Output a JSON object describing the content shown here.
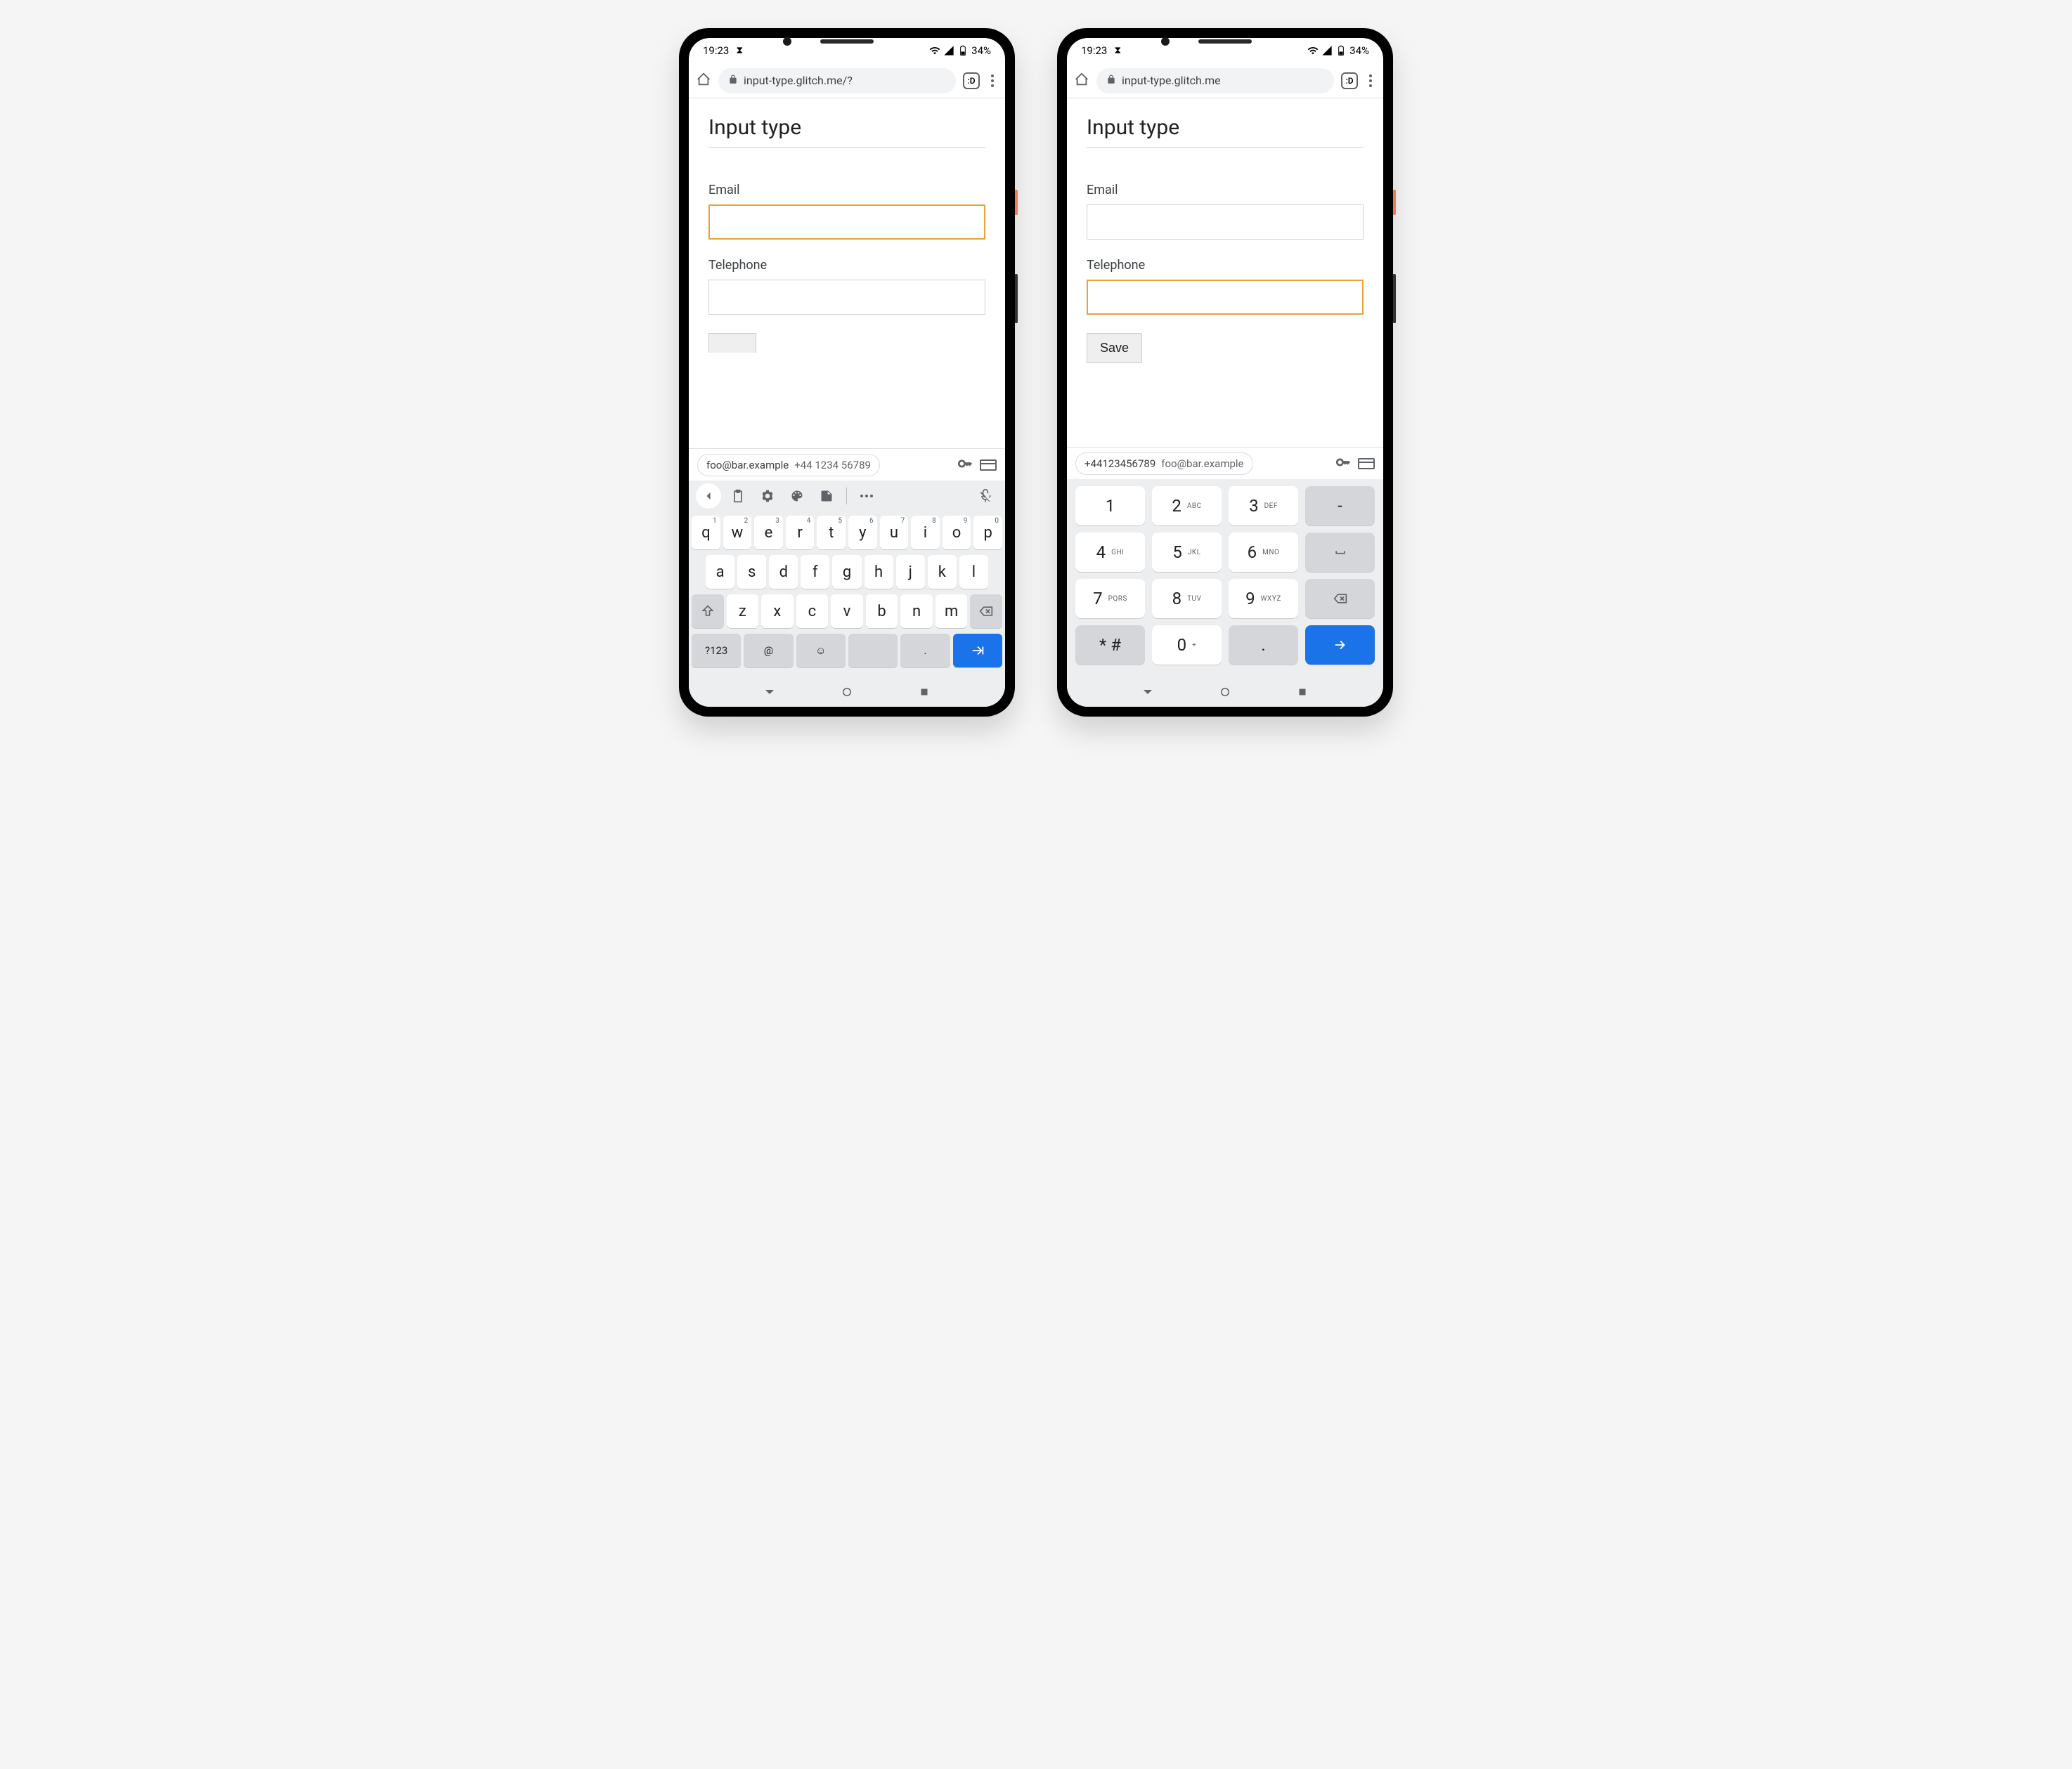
{
  "status": {
    "time": "19:23",
    "battery": "34%"
  },
  "browser": {
    "url_left": "input-type.glitch.me/?",
    "url_right": "input-type.glitch.me",
    "tab_count": ":D"
  },
  "page": {
    "title": "Input type",
    "email_label": "Email",
    "telephone_label": "Telephone",
    "save_label": "Save"
  },
  "autofill": {
    "left_chip_primary": "foo@bar.example",
    "left_chip_secondary": "+44 1234 56789",
    "right_chip_primary": "+44123456789",
    "right_chip_secondary": "foo@bar.example"
  },
  "qwerty": {
    "row1": [
      {
        "k": "q",
        "n": "1"
      },
      {
        "k": "w",
        "n": "2"
      },
      {
        "k": "e",
        "n": "3"
      },
      {
        "k": "r",
        "n": "4"
      },
      {
        "k": "t",
        "n": "5"
      },
      {
        "k": "y",
        "n": "6"
      },
      {
        "k": "u",
        "n": "7"
      },
      {
        "k": "i",
        "n": "8"
      },
      {
        "k": "o",
        "n": "9"
      },
      {
        "k": "p",
        "n": "0"
      }
    ],
    "row2": [
      "a",
      "s",
      "d",
      "f",
      "g",
      "h",
      "j",
      "k",
      "l"
    ],
    "row3": [
      "z",
      "x",
      "c",
      "v",
      "b",
      "n",
      "m"
    ],
    "symbols_label": "?123",
    "at_label": "@",
    "period_label": "."
  },
  "numpad": {
    "keys": [
      [
        {
          "d": "1",
          "s": ""
        },
        {
          "d": "2",
          "s": "ABC"
        },
        {
          "d": "3",
          "s": "DEF"
        },
        {
          "d": "-",
          "s": "",
          "fn": true
        }
      ],
      [
        {
          "d": "4",
          "s": "GHI"
        },
        {
          "d": "5",
          "s": "JKL"
        },
        {
          "d": "6",
          "s": "MNO"
        },
        {
          "d": "␣",
          "s": "",
          "fn": true,
          "icon": "space"
        }
      ],
      [
        {
          "d": "7",
          "s": "PQRS"
        },
        {
          "d": "8",
          "s": "TUV"
        },
        {
          "d": "9",
          "s": "WXYZ"
        },
        {
          "d": "",
          "s": "",
          "fn": true,
          "icon": "bksp"
        }
      ],
      [
        {
          "d": "* #",
          "s": "",
          "fn": true
        },
        {
          "d": "0",
          "s": "+"
        },
        {
          "d": ".",
          "s": "",
          "fn": true
        },
        {
          "d": "",
          "s": "",
          "fn": true,
          "icon": "enter"
        }
      ]
    ]
  }
}
